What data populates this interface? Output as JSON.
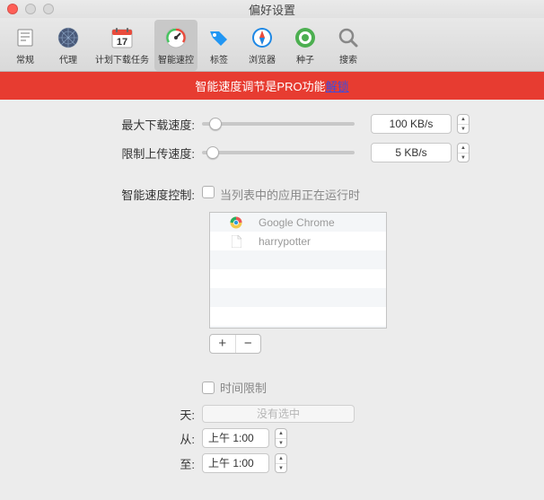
{
  "window": {
    "title": "偏好设置"
  },
  "toolbar": {
    "items": [
      {
        "label": "常规"
      },
      {
        "label": "代理"
      },
      {
        "label": "计划下载任务",
        "calendar_day": "17"
      },
      {
        "label": "智能速控"
      },
      {
        "label": "标签"
      },
      {
        "label": "浏览器"
      },
      {
        "label": "种子"
      },
      {
        "label": "搜索"
      }
    ]
  },
  "banner": {
    "text": "智能速度调节是PRO功能",
    "link": "解锁"
  },
  "speed": {
    "max_down_label": "最大下载速度:",
    "max_down_value": "100 KB/s",
    "limit_up_label": "限制上传速度:",
    "limit_up_value": "5 KB/s"
  },
  "smart": {
    "label": "智能速度控制:",
    "check_label": "当列表中的应用正在运行时",
    "apps": [
      {
        "name": "Google Chrome"
      },
      {
        "name": "harrypotter"
      }
    ]
  },
  "time": {
    "check_label": "时间限制",
    "day_label": "天:",
    "day_value": "没有选中",
    "from_label": "从:",
    "from_value": "上午 1:00",
    "to_label": "至:",
    "to_value": "上午 1:00"
  }
}
